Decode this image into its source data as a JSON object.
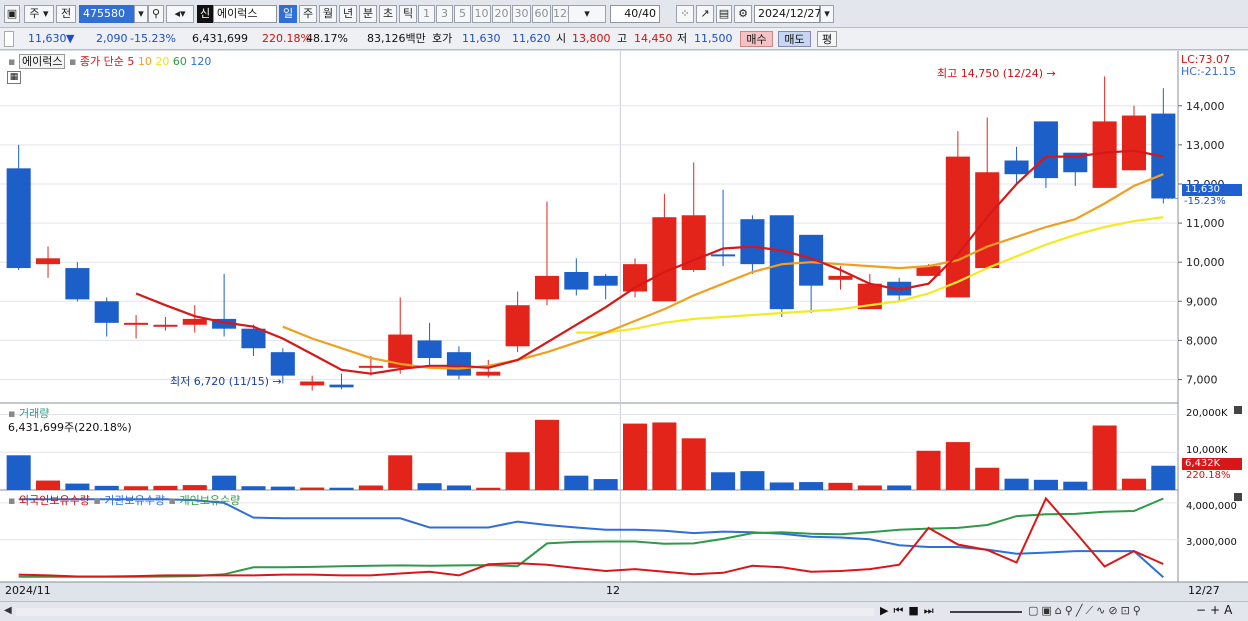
{
  "toolbar": {
    "mode1": "주",
    "mode2": "전",
    "code": "475580",
    "market_badge": "신",
    "stock_name": "에이럭스",
    "periods": [
      "일",
      "주",
      "월",
      "년",
      "분",
      "초",
      "틱"
    ],
    "counts": [
      "1",
      "3",
      "5",
      "10",
      "20",
      "30",
      "60",
      "120"
    ],
    "page_count": "40",
    "page_total": "/40",
    "date": "2024/12/27"
  },
  "quote": {
    "price": "11,630",
    "arrow": "▼",
    "change": "2,090",
    "change_pct": "-15.23%",
    "volume": "6,431,699",
    "vol_ratio": "220.18%",
    "turnover": "48.17%",
    "amount": "83,126백만",
    "bid_label": "호가",
    "ask": "11,630",
    "bid": "11,620",
    "open_label": "시",
    "open": "13,800",
    "high_label": "고",
    "high": "14,450",
    "low_label": "저",
    "low": "11,500",
    "buy_btn": "매수",
    "sell_btn": "매도",
    "eval_btn": "평"
  },
  "price_panel": {
    "name_tag": "에이럭스",
    "legend_label": "종가 단순",
    "ma_labels": [
      "5",
      "10",
      "20",
      "60",
      "120"
    ],
    "ma_colors": [
      "#d81818",
      "#f0a020",
      "#f0e020",
      "#2e9a4a",
      "#2f6fd6"
    ],
    "lc": "LC:73.07",
    "hc": "HC:-21.15",
    "max_label": "최고 14,750 (12/24)",
    "min_label": "최저 6,720 (11/15)",
    "last_price": "11,630",
    "last_pct": "-15.23%"
  },
  "volume_panel": {
    "title": "거래량",
    "value": "6,431,699주(220.18%)",
    "axis": [
      "20,000K",
      "10,000K"
    ],
    "last": "6,432K",
    "last_pct": "220.18%"
  },
  "holding_panel": {
    "legend": [
      "외국인보유수량",
      "기관보유수량",
      "개인보유수량"
    ],
    "legend_colors": [
      "#d81818",
      "#2f6fd6",
      "#2e9a4a"
    ],
    "axis": [
      "4,000,000",
      "3,000,000"
    ]
  },
  "xaxis": {
    "left": "2024/11",
    "mid": "12",
    "right": "12/27"
  },
  "chart_data": {
    "type": "candlestick",
    "dates": [
      "11/01",
      "11/04",
      "11/05",
      "11/06",
      "11/07",
      "11/08",
      "11/11",
      "11/12",
      "11/13",
      "11/14",
      "11/15",
      "11/18",
      "11/19",
      "11/20",
      "11/21",
      "11/22",
      "11/25",
      "11/26",
      "11/27",
      "11/28",
      "11/29",
      "12/02",
      "12/03",
      "12/04",
      "12/05",
      "12/06",
      "12/09",
      "12/10",
      "12/11",
      "12/12",
      "12/13",
      "12/16",
      "12/17",
      "12/18",
      "12/19",
      "12/20",
      "12/23",
      "12/24",
      "12/26",
      "12/27"
    ],
    "open": [
      12400,
      9950,
      9850,
      9000,
      8400,
      8350,
      8400,
      8550,
      8300,
      7700,
      6850,
      6870,
      7300,
      7300,
      8000,
      7700,
      7100,
      7850,
      9050,
      9750,
      9650,
      9250,
      9000,
      9800,
      10200,
      11100,
      11200,
      10700,
      9550,
      8800,
      9500,
      9650,
      9100,
      9850,
      12600,
      13600,
      12800,
      11900,
      12350,
      13800
    ],
    "close": [
      9850,
      10100,
      9050,
      8450,
      8450,
      8400,
      8550,
      8300,
      7800,
      7100,
      6950,
      6800,
      7350,
      8150,
      7550,
      7100,
      7200,
      8900,
      9650,
      9300,
      9400,
      9950,
      11150,
      11200,
      10150,
      9950,
      8800,
      9400,
      9650,
      9450,
      9150,
      9900,
      12700,
      12300,
      12250,
      12150,
      12300,
      13600,
      13750,
      11630
    ],
    "high": [
      13000,
      10400,
      10000,
      9100,
      8650,
      8600,
      8900,
      9700,
      8400,
      7800,
      7100,
      7150,
      7600,
      9100,
      8450,
      7850,
      7500,
      9250,
      11550,
      10100,
      9700,
      10100,
      11750,
      12550,
      11850,
      11200,
      9700,
      10200,
      9900,
      9700,
      9600,
      9950,
      13350,
      13700,
      12950,
      12600,
      12700,
      14750,
      14000,
      14450
    ],
    "low": [
      9800,
      9600,
      9000,
      8100,
      8050,
      8250,
      8200,
      8100,
      7600,
      6900,
      6720,
      6750,
      7100,
      7150,
      7300,
      7000,
      7050,
      7700,
      8900,
      9150,
      9050,
      9100,
      9500,
      9750,
      9900,
      9700,
      8600,
      8700,
      9300,
      9200,
      9000,
      9800,
      11950,
      12100,
      12000,
      11900,
      11950,
      12400,
      13200,
      11500
    ],
    "ma5": [
      null,
      null,
      null,
      null,
      9200,
      8900,
      8620,
      8460,
      8350,
      8050,
      7650,
      7250,
      7150,
      7270,
      7350,
      7350,
      7300,
      7500,
      7950,
      8400,
      8850,
      9350,
      9750,
      10050,
      10350,
      10400,
      10300,
      10100,
      9800,
      9450,
      9300,
      9450,
      10200,
      11150,
      12000,
      12700,
      12700,
      12800,
      12850,
      12700
    ],
    "ma10": [
      null,
      null,
      null,
      null,
      null,
      null,
      null,
      null,
      null,
      8350,
      8050,
      7800,
      7550,
      7400,
      7300,
      7280,
      7350,
      7500,
      7700,
      7950,
      8200,
      8500,
      8800,
      9150,
      9450,
      9750,
      9950,
      10000,
      9950,
      9900,
      9850,
      9900,
      10050,
      10400,
      10650,
      10900,
      11100,
      11500,
      11950,
      12250
    ],
    "ma20": [
      null,
      null,
      null,
      null,
      null,
      null,
      null,
      null,
      null,
      null,
      null,
      null,
      null,
      null,
      null,
      null,
      null,
      null,
      null,
      8200,
      8200,
      8300,
      8450,
      8550,
      8600,
      8650,
      8700,
      8750,
      8800,
      8900,
      9000,
      9200,
      9500,
      9850,
      10150,
      10450,
      10700,
      10900,
      11050,
      11150
    ],
    "volume_k": [
      9200,
      2500,
      1700,
      1100,
      1000,
      1100,
      1300,
      3800,
      1000,
      900,
      650,
      600,
      1200,
      9200,
      1800,
      1200,
      600,
      10000,
      18600,
      3800,
      2900,
      17600,
      17900,
      13700,
      4700,
      5000,
      2000,
      2100,
      1900,
      1200,
      1200,
      10400,
      12700,
      5900,
      3000,
      2700,
      2200,
      17100,
      3000,
      6432
    ],
    "foreign": [
      2050000,
      2030000,
      2000000,
      2000000,
      2010000,
      2030000,
      2030000,
      2030000,
      2030000,
      2050000,
      2050000,
      2030000,
      2030000,
      2080000,
      2130000,
      2030000,
      2330000,
      2360000,
      2320000,
      2230000,
      2150000,
      2200000,
      2130000,
      2060000,
      2100000,
      2290000,
      2250000,
      2130000,
      2150000,
      2200000,
      2320000,
      3320000,
      2870000,
      2720000,
      2380000,
      4120000,
      3210000,
      2270000,
      2690000,
      2340000
    ],
    "institution": [
      4100000,
      4100000,
      4100000,
      4100000,
      4100000,
      4100000,
      4070000,
      4000000,
      3600000,
      3580000,
      3580000,
      3580000,
      3580000,
      3580000,
      3330000,
      3330000,
      3330000,
      3490000,
      3400000,
      3330000,
      3270000,
      3270000,
      3240000,
      3180000,
      3220000,
      3200000,
      3160000,
      3080000,
      3060000,
      3010000,
      2850000,
      2800000,
      2800000,
      2730000,
      2620000,
      2650000,
      2690000,
      2690000,
      2690000,
      1980000
    ],
    "individual": [
      1990000,
      1990000,
      1990000,
      1990000,
      1990000,
      2000000,
      2010000,
      2060000,
      2250000,
      2250000,
      2260000,
      2280000,
      2290000,
      2300000,
      2290000,
      2300000,
      2310000,
      2280000,
      2900000,
      2940000,
      2950000,
      2950000,
      2890000,
      2900000,
      3020000,
      3180000,
      3200000,
      3160000,
      3150000,
      3200000,
      3270000,
      3300000,
      3320000,
      3400000,
      3640000,
      3690000,
      3700000,
      3760000,
      3780000,
      4120000
    ],
    "y_ticks": [
      7000,
      8000,
      9000,
      10000,
      11000,
      12000,
      13000,
      14000
    ],
    "ylim": [
      6400,
      15400
    ]
  }
}
